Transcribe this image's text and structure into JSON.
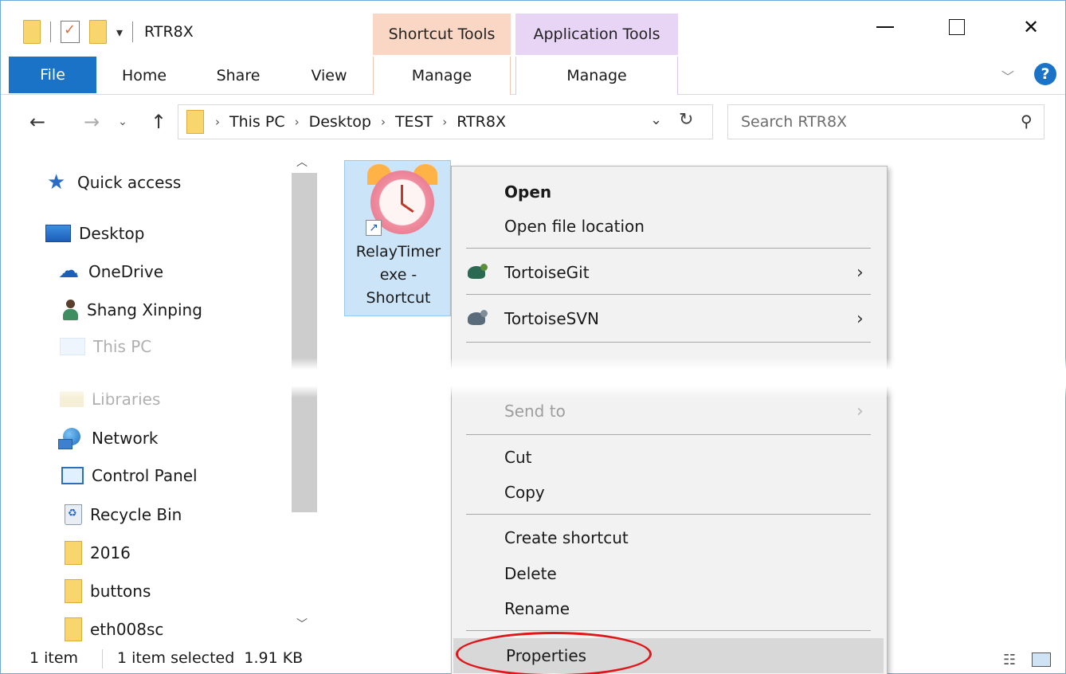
{
  "window": {
    "title": "RTR8X",
    "context_tab_groups": [
      "Shortcut Tools",
      "Application Tools"
    ]
  },
  "ribbon": {
    "tabs": [
      "File",
      "Home",
      "Share",
      "View",
      "Manage",
      "Manage"
    ]
  },
  "address": {
    "crumbs": [
      "This PC",
      "Desktop",
      "TEST",
      "RTR8X"
    ],
    "search_placeholder": "Search RTR8X"
  },
  "nav": {
    "items": [
      {
        "label": "Quick access",
        "icon": "star-icon"
      },
      {
        "label": "Desktop",
        "icon": "desktop-icon"
      },
      {
        "label": "OneDrive",
        "icon": "onedrive-cloud-icon"
      },
      {
        "label": "Shang Xinping",
        "icon": "user-icon"
      },
      {
        "label": "This PC",
        "icon": "computer-icon"
      },
      {
        "label": "Libraries",
        "icon": "libraries-icon"
      },
      {
        "label": "Network",
        "icon": "network-icon"
      },
      {
        "label": "Control Panel",
        "icon": "control-panel-icon"
      },
      {
        "label": "Recycle Bin",
        "icon": "recycle-bin-icon"
      },
      {
        "label": "2016",
        "icon": "folder-icon"
      },
      {
        "label": "buttons",
        "icon": "folder-icon"
      },
      {
        "label": "eth008sc",
        "icon": "folder-icon"
      }
    ]
  },
  "content": {
    "file_label": "RelayTimer\nexe -\nShortcut"
  },
  "context_menu": {
    "items": [
      {
        "label": "Open",
        "bold": true
      },
      {
        "label": "Open file location"
      },
      {
        "label": "TortoiseGit",
        "submenu": true
      },
      {
        "label": "TortoiseSVN",
        "submenu": true
      },
      {
        "label": "Send to",
        "submenu": true,
        "disabled": true
      },
      {
        "label": "Cut"
      },
      {
        "label": "Copy"
      },
      {
        "label": "Create shortcut"
      },
      {
        "label": "Delete"
      },
      {
        "label": "Rename"
      },
      {
        "label": "Properties",
        "highlighted": true
      }
    ]
  },
  "status": {
    "item_count": "1 item",
    "selection": "1 item selected  1.91 KB"
  },
  "colors": {
    "file_tab": "#1a73c7",
    "shortcut_tools": "#f9d7c4",
    "application_tools": "#e8d5f6",
    "selection": "#cce4f8",
    "annotation_ellipse": "#e0161b"
  }
}
